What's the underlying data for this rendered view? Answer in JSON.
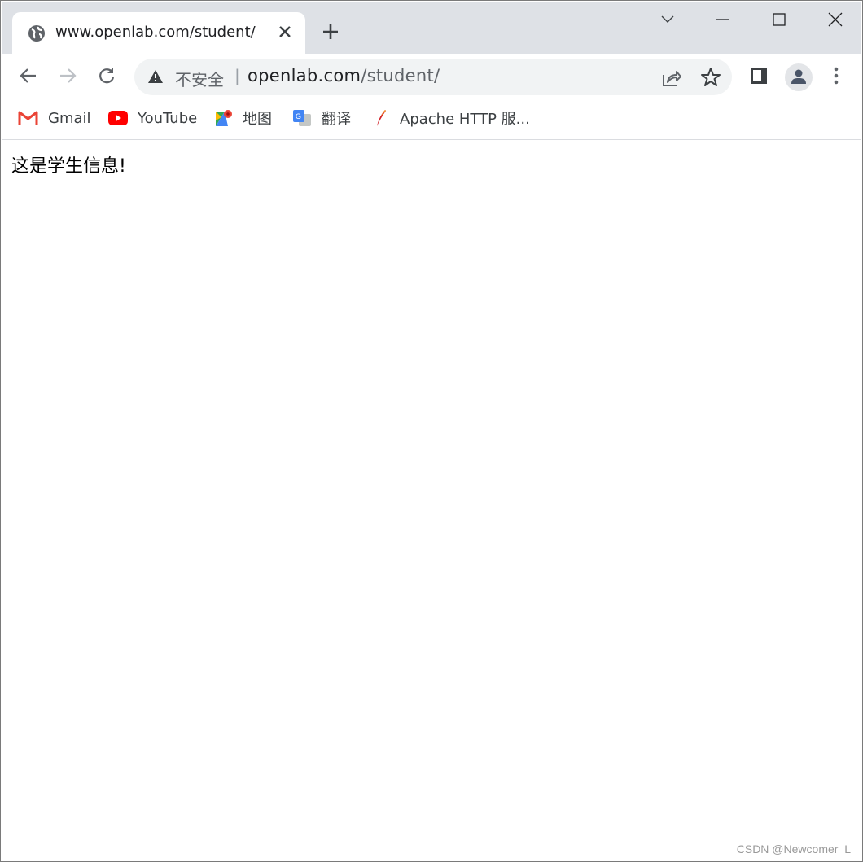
{
  "tab": {
    "title": "www.openlab.com/student/"
  },
  "address_bar": {
    "security_label": "不安全",
    "separator": "|",
    "url_host": "openlab.com",
    "url_path": "/student/"
  },
  "bookmarks": [
    {
      "label": "Gmail",
      "icon": "gmail-icon"
    },
    {
      "label": "YouTube",
      "icon": "youtube-icon"
    },
    {
      "label": "地图",
      "icon": "maps-icon"
    },
    {
      "label": "翻译",
      "icon": "translate-icon"
    },
    {
      "label": "Apache HTTP 服...",
      "icon": "apache-feather-icon"
    }
  ],
  "page": {
    "text": "这是学生信息!"
  },
  "watermark": "CSDN @Newcomer_L",
  "colors": {
    "tabstrip": "#dee1e6",
    "omnibox": "#f1f3f4",
    "icon": "#5f6368"
  }
}
